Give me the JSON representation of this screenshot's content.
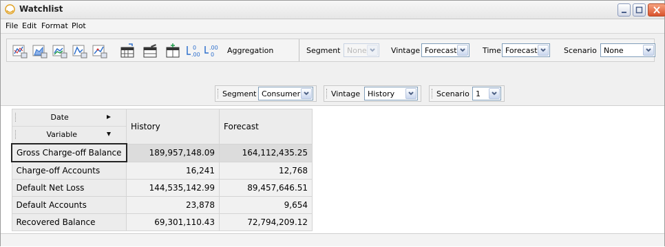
{
  "window": {
    "title": "Watchlist"
  },
  "menu": [
    "File",
    "Edit",
    "Format",
    "Plot"
  ],
  "toolbar": {
    "aggregation_label": "Aggregation",
    "segment": {
      "label": "Segment",
      "value": "None",
      "disabled": true
    },
    "vintage": {
      "label": "Vintage",
      "value": "Forecast"
    },
    "time": {
      "label": "Time",
      "value": "Forecast"
    },
    "scenario": {
      "label": "Scenario",
      "value": "None"
    }
  },
  "filters": {
    "segment": {
      "label": "Segment",
      "value": "Consumer"
    },
    "vintage": {
      "label": "Vintage",
      "value": "History"
    },
    "scenario": {
      "label": "Scenario",
      "value": "1"
    }
  },
  "grid": {
    "dimensions": {
      "column_dim": "Date",
      "row_dim": "Variable"
    },
    "columns": [
      "History",
      "Forecast"
    ],
    "rows": [
      {
        "label": "Gross Charge-off Balance",
        "values": [
          "189,957,148.09",
          "164,112,435.25"
        ]
      },
      {
        "label": "Charge-off Accounts",
        "values": [
          "16,241",
          "12,768"
        ]
      },
      {
        "label": "Default Net Loss",
        "values": [
          "144,535,142.99",
          "89,457,646.51"
        ]
      },
      {
        "label": "Default Accounts",
        "values": [
          "23,878",
          "9,654"
        ]
      },
      {
        "label": "Recovered Balance",
        "values": [
          "69,301,110.43",
          "72,794,209.12"
        ]
      }
    ]
  },
  "colors": {
    "accent": "#7f9db9",
    "close": "#d9532e"
  }
}
